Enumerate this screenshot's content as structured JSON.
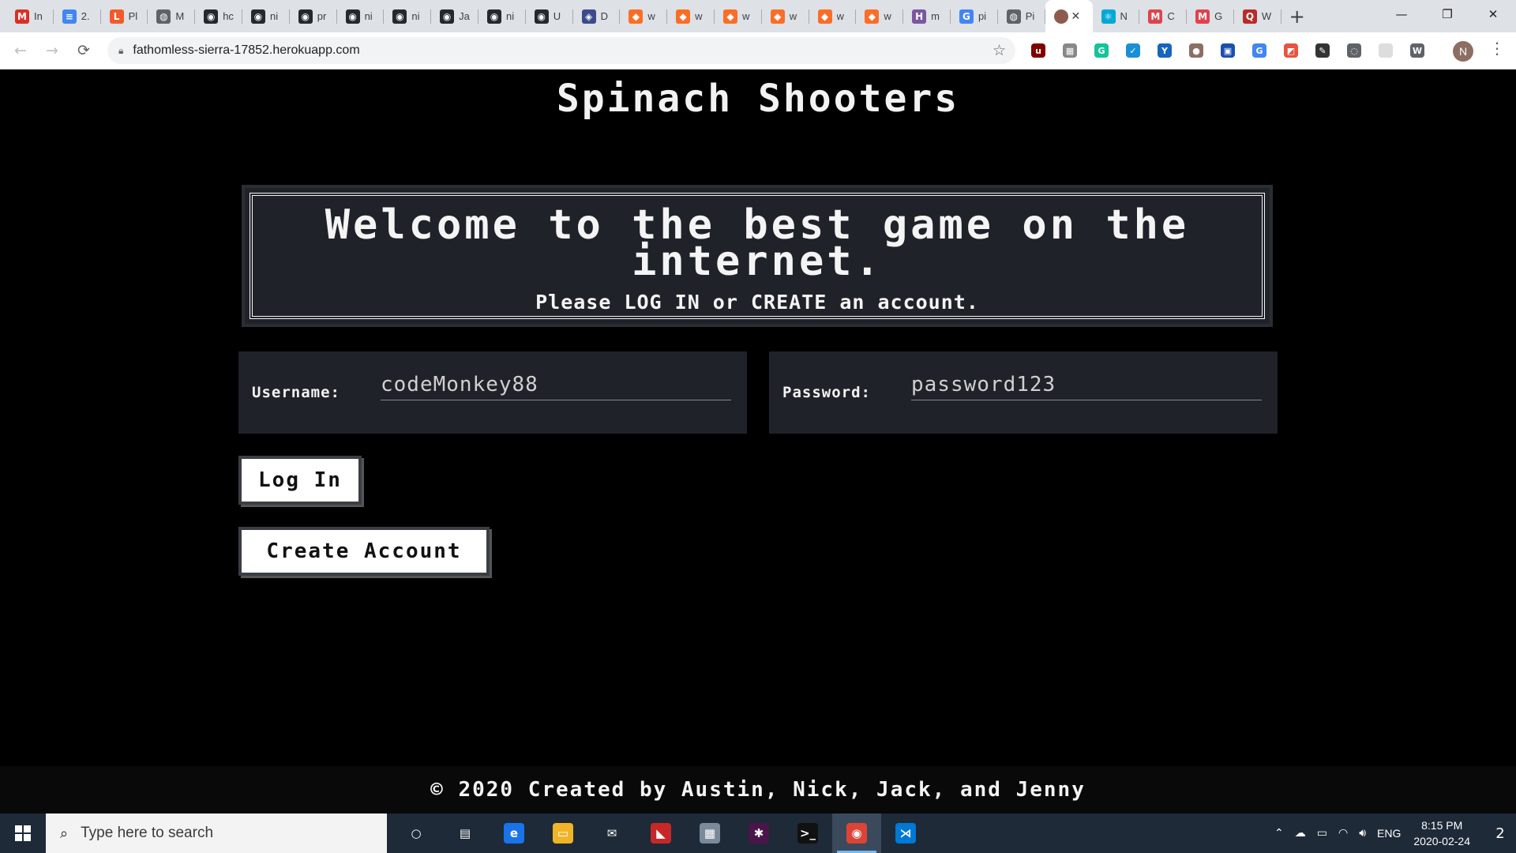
{
  "browser": {
    "tabs": [
      {
        "icon": "gmail-icon",
        "letter": "M",
        "color": "#d93025",
        "title": "In"
      },
      {
        "icon": "docs-icon",
        "letter": "≡",
        "color": "#4285f4",
        "title": "2."
      },
      {
        "icon": "pluralsight-icon",
        "letter": "L",
        "color": "#f15b2a",
        "title": "Pl"
      },
      {
        "icon": "globe-icon",
        "letter": "◍",
        "color": "#5f6368",
        "title": "M"
      },
      {
        "icon": "github-icon",
        "letter": "◉",
        "color": "#24292e",
        "title": "hc"
      },
      {
        "icon": "github-icon",
        "letter": "◉",
        "color": "#24292e",
        "title": "ni"
      },
      {
        "icon": "github-icon",
        "letter": "◉",
        "color": "#24292e",
        "title": "pr"
      },
      {
        "icon": "github-icon",
        "letter": "◉",
        "color": "#24292e",
        "title": "ni"
      },
      {
        "icon": "github-icon",
        "letter": "◉",
        "color": "#24292e",
        "title": "ni"
      },
      {
        "icon": "github-icon",
        "letter": "◉",
        "color": "#24292e",
        "title": "Ja"
      },
      {
        "icon": "github-icon",
        "letter": "◉",
        "color": "#24292e",
        "title": "ni"
      },
      {
        "icon": "github-icon",
        "letter": "◉",
        "color": "#24292e",
        "title": "U"
      },
      {
        "icon": "shield-icon",
        "letter": "◈",
        "color": "#3d4b8c",
        "title": "D"
      },
      {
        "icon": "gitlab-icon",
        "letter": "◆",
        "color": "#fc6d26",
        "title": "w"
      },
      {
        "icon": "gitlab-icon",
        "letter": "◆",
        "color": "#fc6d26",
        "title": "w"
      },
      {
        "icon": "gitlab-icon",
        "letter": "◆",
        "color": "#fc6d26",
        "title": "w"
      },
      {
        "icon": "gitlab-icon",
        "letter": "◆",
        "color": "#fc6d26",
        "title": "w"
      },
      {
        "icon": "gitlab-icon",
        "letter": "◆",
        "color": "#fc6d26",
        "title": "w"
      },
      {
        "icon": "gitlab-icon",
        "letter": "◆",
        "color": "#fc6d26",
        "title": "w"
      },
      {
        "icon": "heroku-icon",
        "letter": "H",
        "color": "#79589f",
        "title": "m"
      },
      {
        "icon": "google-icon",
        "letter": "G",
        "color": "#4285f4",
        "title": "pi"
      },
      {
        "icon": "globe-icon",
        "letter": "◍",
        "color": "#5f6368",
        "title": "Pi"
      }
    ],
    "active_tab": {
      "icon": "avatar-icon",
      "color": "#8d5b4c",
      "close": "✕"
    },
    "tabs_after": [
      {
        "icon": "react-icon",
        "letter": "⚛",
        "color": "#00a8d6",
        "title": "N"
      },
      {
        "icon": "mdn-icon",
        "letter": "M",
        "color": "#e0434c",
        "title": "C"
      },
      {
        "icon": "mdn-icon",
        "letter": "M",
        "color": "#e0434c",
        "title": "G"
      },
      {
        "icon": "quora-icon",
        "letter": "Q",
        "color": "#b92b27",
        "title": "W"
      }
    ],
    "new_tab": "+",
    "window_controls": {
      "minimize": "—",
      "maximize": "❐",
      "close": "✕"
    },
    "url": "fathomless-sierra-17852.herokuapp.com",
    "nav": {
      "back": "←",
      "forward": "→",
      "reload": "⟳"
    },
    "star": "☆",
    "extensions": [
      {
        "icon": "ublock-icon",
        "color": "#800000",
        "letter": "u"
      },
      {
        "icon": "puzzle-icon",
        "color": "#888888",
        "letter": "▦"
      },
      {
        "icon": "grammarly-icon",
        "color": "#15c39a",
        "letter": "G"
      },
      {
        "icon": "check-icon",
        "color": "#1a8fd8",
        "letter": "✓"
      },
      {
        "icon": "y-icon",
        "color": "#1565c0",
        "letter": "Y"
      },
      {
        "icon": "cookie-icon",
        "color": "#8d6e63",
        "letter": "●"
      },
      {
        "icon": "book-icon",
        "color": "#1a4fb0",
        "letter": "▣"
      },
      {
        "icon": "translate-icon",
        "color": "#4285f4",
        "letter": "G"
      },
      {
        "icon": "shapes-icon",
        "color": "#e8533f",
        "letter": "◩"
      },
      {
        "icon": "pen-icon",
        "color": "#333333",
        "letter": "✎"
      },
      {
        "icon": "code-icon",
        "color": "#5f6368",
        "letter": "◌"
      },
      {
        "icon": "blank-icon",
        "color": "#dddddd",
        "letter": " "
      },
      {
        "icon": "wordpress-icon",
        "color": "#5f6368",
        "letter": "W"
      }
    ],
    "profile_letter": "N",
    "menu": "⋮"
  },
  "page": {
    "title": "Spinach Shooters",
    "welcome_heading": "Welcome to the best game on the internet.",
    "welcome_sub": "Please LOG IN or CREATE an account.",
    "username_label": "Username:",
    "username_value": "codeMonkey88",
    "password_label": "Password:",
    "password_value": "password123",
    "login_button": "Log In",
    "create_button": "Create Account",
    "footer": "© 2020 Created by Austin, Nick, Jack, and Jenny"
  },
  "taskbar": {
    "search_placeholder": "Type here to search",
    "apps": [
      {
        "icon": "cortana-icon",
        "letter": "○",
        "color": "transparent"
      },
      {
        "icon": "task-view-icon",
        "letter": "▤",
        "color": "transparent"
      },
      {
        "icon": "edge-icon",
        "letter": "e",
        "color": "#1a73e8"
      },
      {
        "icon": "file-explorer-icon",
        "letter": "▭",
        "color": "#f0b429"
      },
      {
        "icon": "mail-icon",
        "letter": "✉",
        "color": "transparent"
      },
      {
        "icon": "game-icon",
        "letter": "◣",
        "color": "#c62828"
      },
      {
        "icon": "app-icon",
        "letter": "▦",
        "color": "#7a8a9a"
      },
      {
        "icon": "slack-icon",
        "letter": "✱",
        "color": "#4a154b"
      },
      {
        "icon": "terminal-icon",
        "letter": ">_",
        "color": "#111111"
      },
      {
        "icon": "chrome-icon",
        "letter": "◉",
        "color": "#db4437"
      },
      {
        "icon": "vscode-icon",
        "letter": "⋊",
        "color": "#0078d4"
      }
    ],
    "language": "ENG",
    "time": "8:15 PM",
    "date": "2020-02-24",
    "notification_count": "2"
  }
}
